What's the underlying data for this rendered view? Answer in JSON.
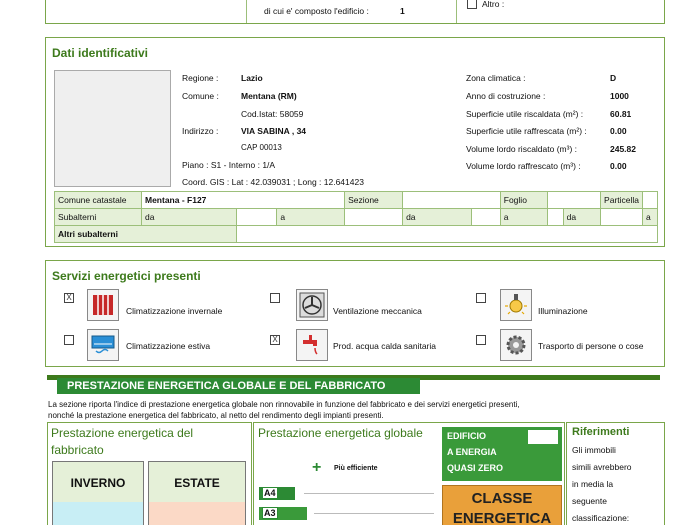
{
  "top": {
    "cut_label": "",
    "composed_label": "di cui e' composto l'edificio :",
    "composed_value": "1",
    "altro_label": "Altro :"
  },
  "dati": {
    "title": "Dati identificativi",
    "regione_label": "Regione :",
    "regione_value": "Lazio",
    "comune_label": "Comune :",
    "comune_value": "Mentana (RM)",
    "istat": "Cod.Istat: 58059",
    "indirizzo_label": "Indirizzo :",
    "indirizzo_value": "VIA SABINA , 34",
    "cap": "CAP 00013",
    "piano": "Piano : S1 - Interno : 1/A",
    "coord": "Coord. GIS : Lat : 42.039031 ; Long : 12.641423",
    "zona_label": "Zona climatica :",
    "zona_value": "D",
    "anno_label": "Anno di costruzione :",
    "anno_value": "1000",
    "sur_risc_label": "Superficie utile riscaldata (m²) :",
    "sur_risc_value": "60.81",
    "sur_raff_label": "Superficie utile raffrescata (m²) :",
    "sur_raff_value": "0.00",
    "vol_risc_label": "Volume lordo riscaldato (m³) :",
    "vol_risc_value": "245.82",
    "vol_raff_label": "Volume lordo raffrescato (m³) :",
    "vol_raff_value": "0.00"
  },
  "catasto": {
    "comune_label": "Comune catastale",
    "comune_value": "Mentana - F127",
    "sezione_label": "Sezione",
    "foglio_label": "Foglio",
    "particella_label": "Particella",
    "subalterni_label": "Subalterni",
    "da": "da",
    "a": "a",
    "altri_label": "Altri subalterni"
  },
  "servizi": {
    "title": "Servizi energetici presenti",
    "items": [
      {
        "label": "Climatizzazione invernale",
        "checked": "X",
        "icon": "radiator-icon"
      },
      {
        "label": "Ventilazione meccanica",
        "checked": "",
        "icon": "fan-icon"
      },
      {
        "label": "Illuminazione",
        "checked": "",
        "icon": "lightbulb-icon"
      },
      {
        "label": "Climatizzazione estiva",
        "checked": "",
        "icon": "air-conditioner-icon"
      },
      {
        "label": "Prod. acqua calda sanitaria",
        "checked": "X",
        "icon": "tap-icon"
      },
      {
        "label": "Trasporto di persone o cose",
        "checked": "",
        "icon": "gear-icon"
      }
    ]
  },
  "prestazione": {
    "header": "PRESTAZIONE ENERGETICA GLOBALE  E DEL FABBRICATO",
    "desc1": "La sezione riporta l'indice di prestazione energetica globale non rinnovabile in funzione del fabbricato e dei servizi energetici presenti,",
    "desc2": "nonché la prestazione energetica del fabbricato, al netto del rendimento degli impianti presenti.",
    "fabbricato_title1": "Prestazione energetica del",
    "fabbricato_title2": "fabbricato",
    "inverno": "INVERNO",
    "estate": "ESTATE",
    "globale_title": "Prestazione energetica globale",
    "piu_efficiente": "Più efficiente",
    "classes": [
      "A4",
      "A3"
    ],
    "nzeb_lines": [
      "EDIFICIO",
      "A ENERGIA",
      "QUASI ZERO"
    ],
    "classe_label_1": "CLASSE",
    "classe_label_2": "ENERGETICA",
    "riferimenti_title": "Riferimenti",
    "riferimenti_text": [
      "Gli immobili",
      "simili avrebbero",
      "in media la",
      "seguente",
      "classificazione:"
    ]
  },
  "colors": {
    "green_border": "#7aa64a",
    "green_title": "#3d7a1c",
    "class_green": "#2c8a34",
    "nzeb_green": "#3a9a3a",
    "classe_orange": "#e9a03a",
    "inverno_blue": "#c8eef5",
    "estate_pink": "#fbd9c6"
  }
}
